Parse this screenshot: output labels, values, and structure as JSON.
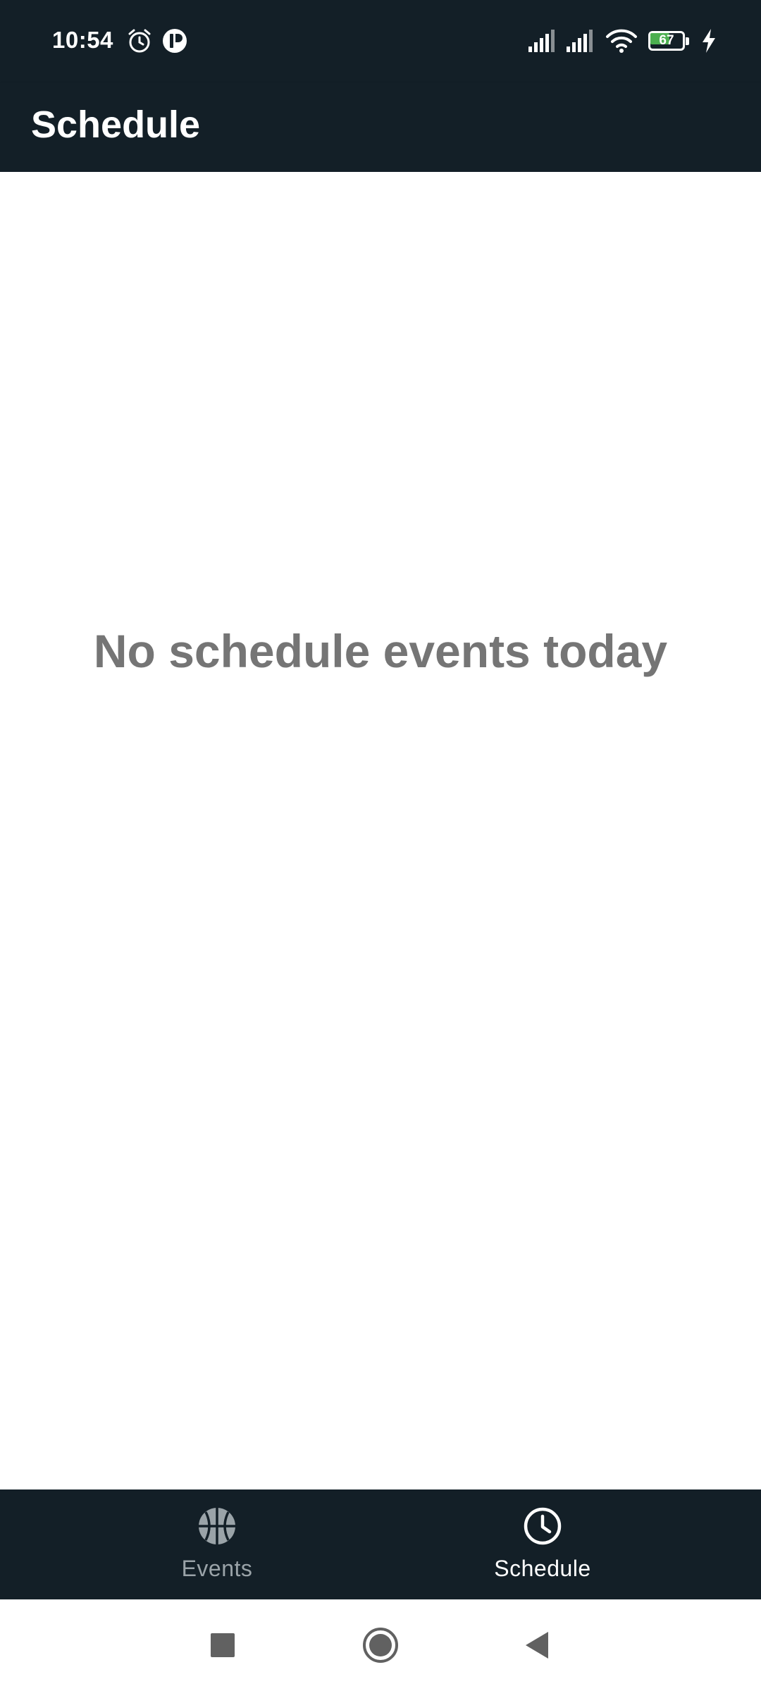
{
  "status_bar": {
    "time": "10:54",
    "battery_level": "67",
    "battery_fraction": 0.67,
    "icons": [
      "alarm-icon",
      "app-notification-icon",
      "signal-icon",
      "signal-icon",
      "wifi-icon",
      "battery-icon",
      "charging-icon"
    ]
  },
  "app_bar": {
    "title": "Schedule"
  },
  "content": {
    "empty_message": "No schedule events today"
  },
  "bottom_nav": {
    "items": [
      {
        "label": "Events",
        "icon": "basketball-icon",
        "active": false
      },
      {
        "label": "Schedule",
        "icon": "clock-icon",
        "active": true
      }
    ]
  },
  "system_nav": {
    "buttons": [
      "recents-button",
      "home-button",
      "back-button"
    ]
  },
  "colors": {
    "bar_background": "#131f27",
    "active_text": "#ffffff",
    "inactive_text": "#9aa3a8",
    "empty_message": "#757575",
    "battery_fill": "#4caf50"
  }
}
